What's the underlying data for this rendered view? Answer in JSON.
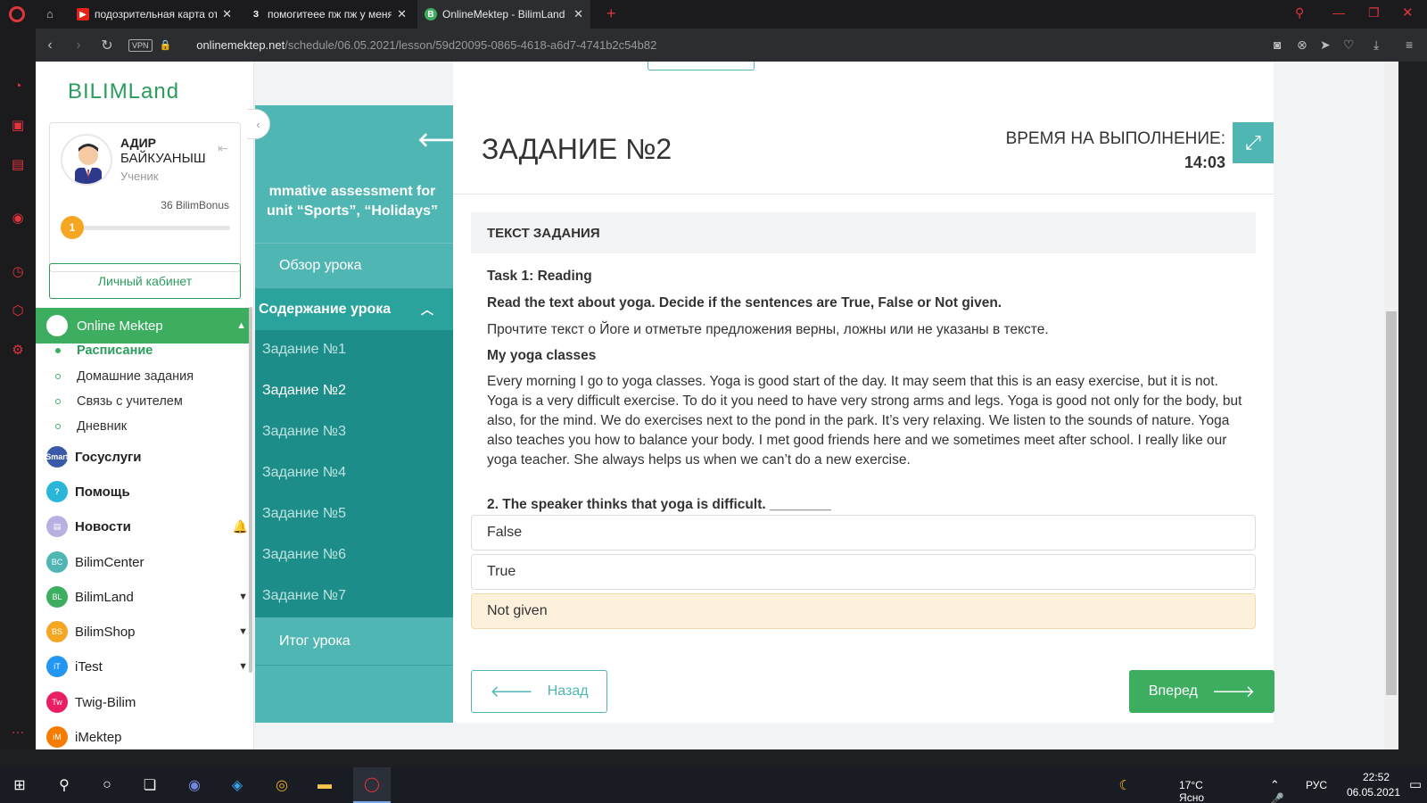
{
  "browser": {
    "tabs": [
      {
        "title": "подозрительная карта от г",
        "icon": "youtube-icon",
        "color": "#e62117",
        "glyph": "▶"
      },
      {
        "title": "помогитеее пж пж у меня",
        "icon": "znanija-icon",
        "color": "#1b1b1d",
        "glyph": "З"
      },
      {
        "title": "OnlineMektep - BilimLand",
        "icon": "bilimland-icon",
        "color": "#3dae5f",
        "glyph": "B"
      }
    ],
    "new_tab": "+",
    "vpn": "VPN",
    "url_host": "onlinemektep.net",
    "url_path": "/schedule/06.05.2021/lesson/59d20095-0865-4618-a6d7-4741b2c54b82"
  },
  "sidebar": {
    "logo": "BILIMLand",
    "user": {
      "first": "АДИР",
      "last": "БАЙКУАНЫШ",
      "role": "Ученик",
      "bonus": "36 BilimBonus",
      "level": "1",
      "progress": 0.12
    },
    "cabinet": "Личный кабинет",
    "section": "Online Mektep",
    "sub_items": [
      "Расписание",
      "Домашние задания",
      "Связь с учителем",
      "Дневник"
    ],
    "items": [
      {
        "label": "Госуслуги",
        "color": "#3a5aa8",
        "bold": true,
        "glyph": "Smart"
      },
      {
        "label": "Помощь",
        "color": "#29b6d8",
        "bold": true,
        "glyph": "?"
      },
      {
        "label": "Новости",
        "color": "#b8b0e0",
        "bold": true,
        "glyph": "▤"
      },
      {
        "label": "BilimCenter",
        "color": "#4fb6b3",
        "bold": false,
        "glyph": "BC"
      },
      {
        "label": "BilimLand",
        "color": "#3dae5f",
        "bold": false,
        "glyph": "BL"
      },
      {
        "label": "BilimShop",
        "color": "#f5a623",
        "bold": false,
        "glyph": "BS"
      },
      {
        "label": "iTest",
        "color": "#2196f3",
        "bold": false,
        "glyph": "iT"
      },
      {
        "label": "Twig-Bilim",
        "color": "#e91e63",
        "bold": false,
        "glyph": "Tw"
      },
      {
        "label": "iMektep",
        "color": "#f57c00",
        "bold": false,
        "glyph": "iM"
      }
    ]
  },
  "lesson_nav": {
    "title_line1": "mmative assessment for",
    "title_line2": "unit “Sports”, “Holidays”",
    "overview": "Обзор урока",
    "content": "Содержание урока",
    "tasks": [
      "Задание №1",
      "Задание №2",
      "Задание №3",
      "Задание №4",
      "Задание №5",
      "Задание №6",
      "Задание №7"
    ],
    "summary": "Итог урока"
  },
  "task": {
    "title": "ЗАДАНИЕ №2",
    "time_label": "ВРЕМЯ НА ВЫПОЛНЕНИЕ:",
    "time_value": "14:03",
    "text_header": "ТЕКСТ ЗАДАНИЯ",
    "heading": "Task 1: Reading",
    "instruction_en": "Read the text about yoga. Decide if the sentences are True, False or Not given.",
    "instruction_ru": "Прочтите текст о Йоге и отметьте предложения верны, ложны или не указаны в тексте.",
    "story_title": "My yoga classes",
    "story": "Every morning I go to yoga classes. Yoga is good start of the day. It may seem that this is an easy exercise, but it is not. Yoga is a very difficult exercise. To do it you need to have very strong arms and legs. Yoga is good not only for the body, but also, for the mind. We do exercises next to the pond in the park. It’s very relaxing. We listen to the sounds of nature. Yoga also teaches you how to balance your body. I met good friends here and we sometimes meet after school. I really like our yoga teacher. She always helps us when we can’t do a new exercise.",
    "question": "2. The speaker thinks that yoga is difficult. ________",
    "options": [
      "False",
      "True",
      "Not given"
    ],
    "selected": 2,
    "back": "Назад",
    "next": "Вперед"
  },
  "taskbar": {
    "weather": "17°C  Ясно",
    "lang": "РУС",
    "time": "22:52",
    "date": "06.05.2021"
  },
  "colors": {
    "accent": "#3dae5f",
    "teal": "#4fb6b3",
    "teal_dark": "#1c8d88",
    "selected": "#fdf1dc"
  }
}
